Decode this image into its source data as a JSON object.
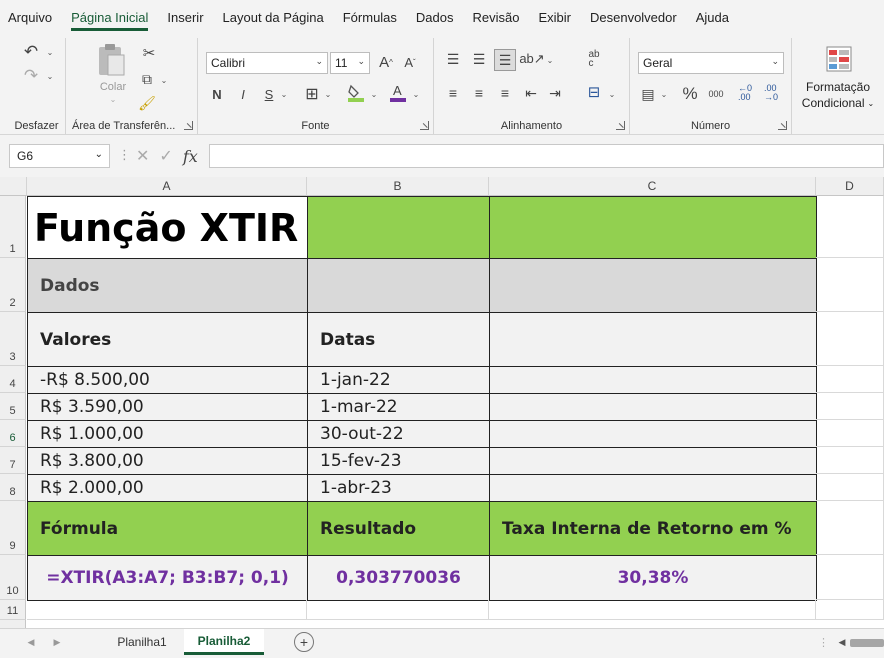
{
  "menu": [
    "Arquivo",
    "Página Inicial",
    "Inserir",
    "Layout da Página",
    "Fórmulas",
    "Dados",
    "Revisão",
    "Exibir",
    "Desenvolvedor",
    "Ajuda"
  ],
  "ribbon": {
    "undo_group": "Desfazer",
    "clipboard_group": "Área de Transferên...",
    "paste_label": "Colar",
    "font_group": "Fonte",
    "font_name": "Calibri",
    "font_size": "11",
    "align_group": "Alinhamento",
    "number_group": "Número",
    "number_format": "Geral",
    "cond_format_line1": "Formatação",
    "cond_format_line2": "Condicional"
  },
  "formula_bar": {
    "name_box": "G6",
    "formula": ""
  },
  "columns": [
    "A",
    "B",
    "C",
    "D"
  ],
  "rows": [
    "1",
    "2",
    "3",
    "4",
    "5",
    "6",
    "7",
    "8",
    "9",
    "10",
    "11"
  ],
  "cells": {
    "A1": "Função XTIR",
    "A2": "Dados",
    "A3": "Valores",
    "B3": "Datas",
    "A4": "-R$ 8.500,00",
    "B4": "1-jan-22",
    "A5": "R$ 3.590,00",
    "B5": "1-mar-22",
    "A6": "R$ 1.000,00",
    "B6": "30-out-22",
    "A7": "R$ 3.800,00",
    "B7": "15-fev-23",
    "A8": "R$ 2.000,00",
    "B8": "1-abr-23",
    "A9": "Fórmula",
    "B9": "Resultado",
    "C9": "Taxa Interna de Retorno em %",
    "A10": "=XTIR(A3:A7; B3:B7; 0,1)",
    "B10": "0,303770036",
    "C10": "30,38%"
  },
  "sheets": [
    "Planilha1",
    "Planilha2"
  ],
  "active_sheet": "Planilha2",
  "colors": {
    "green_fill": "#92d050",
    "gray_fill": "#d9d9d9",
    "light_fill": "#f2f2f2",
    "result_text": "#7030a0",
    "accent": "#185c37"
  }
}
